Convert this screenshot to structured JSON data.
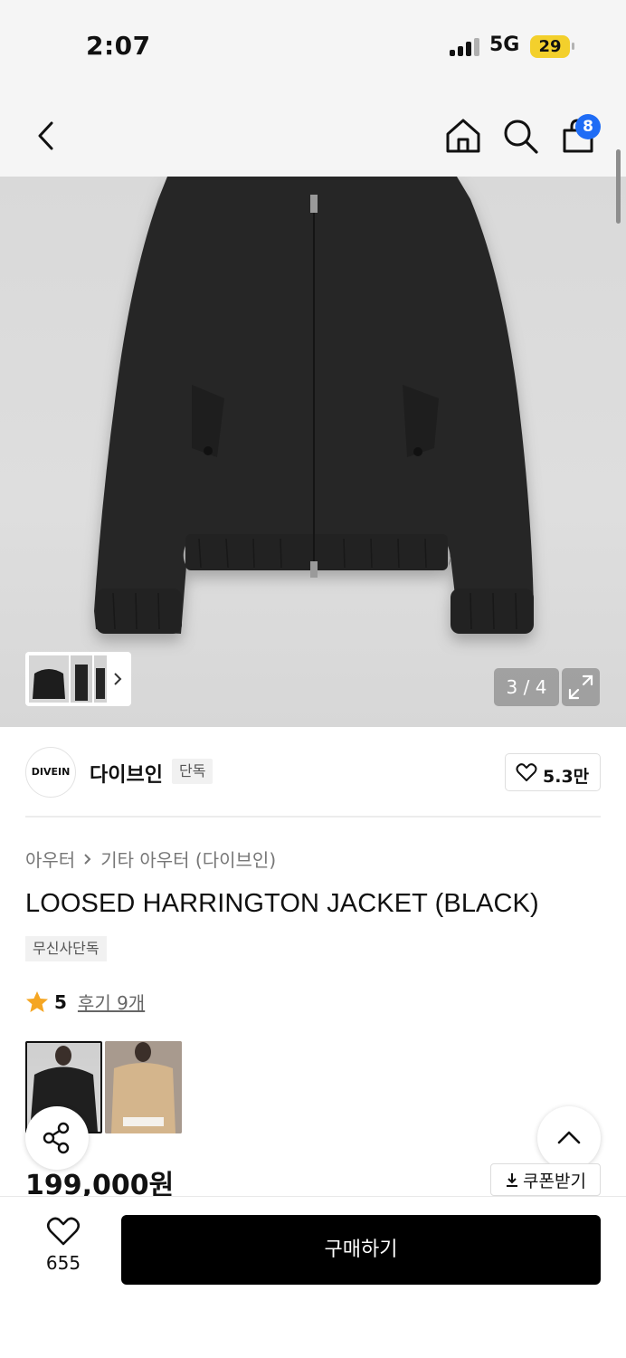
{
  "status_bar": {
    "time": "2:07",
    "network": "5G",
    "battery": "29"
  },
  "header": {
    "cart_count": "8"
  },
  "gallery": {
    "counter": "3 / 4"
  },
  "brand": {
    "logo_text": "DIVEIN",
    "name": "다이브인",
    "tag": "단독",
    "like_count": "5.3만"
  },
  "product": {
    "breadcrumb": [
      "아우터",
      "기타 아우터 (다이브인)"
    ],
    "title": "LOOSED HARRINGTON JACKET (BLACK)",
    "exclusive_tag": "무신사단독",
    "rating": "5",
    "reviews": "후기 9개",
    "price": "199,000원",
    "coupon_label": "쿠폰받기"
  },
  "bottom_bar": {
    "wish_count": "655",
    "buy_label": "구매하기"
  },
  "colors": {
    "accent_badge": "#1f6cf5",
    "star": "#f5a623",
    "buy_button": "#000000",
    "battery": "#f3d02c"
  },
  "icons": [
    "back-arrow-icon",
    "home-icon",
    "search-icon",
    "shopping-bag-icon",
    "expand-icon",
    "heart-icon",
    "star-icon",
    "share-icon",
    "chevron-up-icon",
    "download-icon"
  ]
}
